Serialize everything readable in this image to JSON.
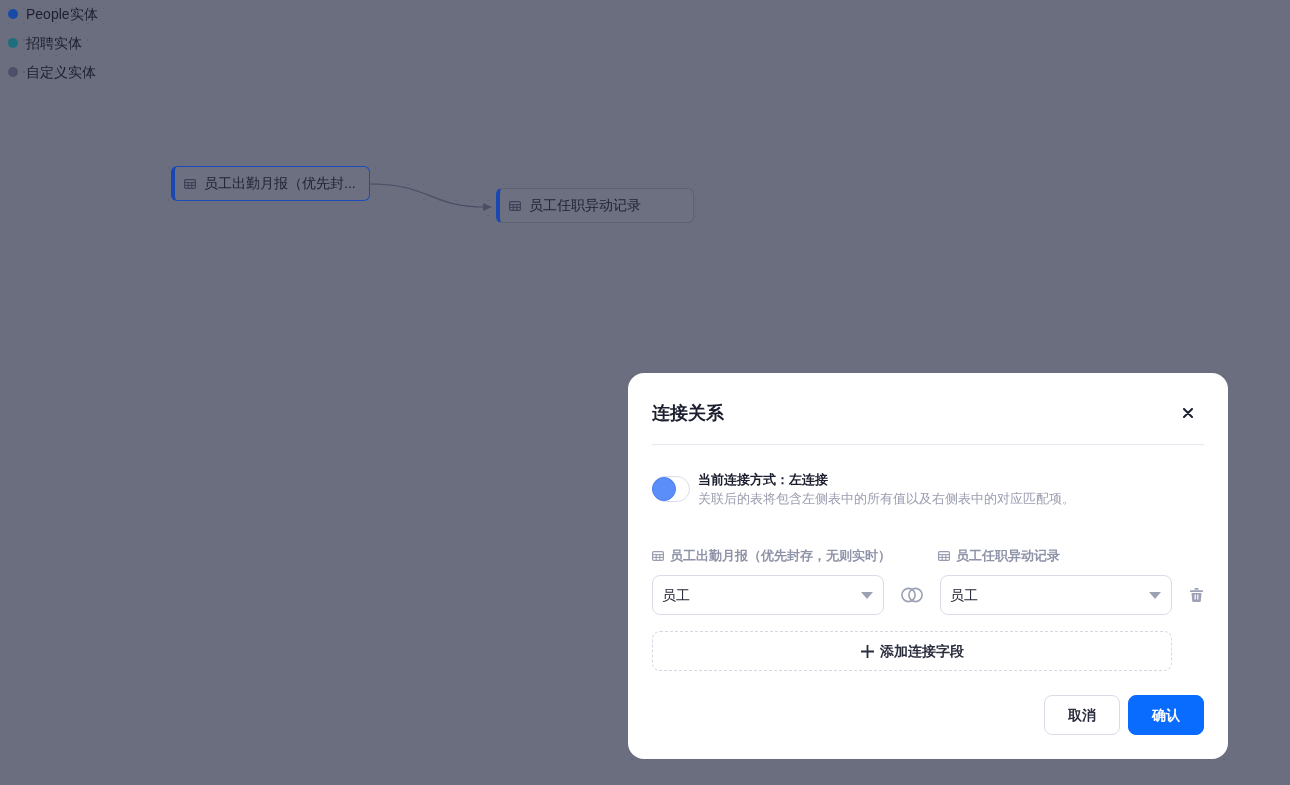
{
  "legend": [
    {
      "label": "People实体",
      "color": "#1a4aa8"
    },
    {
      "label": "招聘实体",
      "color": "#1d6f80"
    },
    {
      "label": "自定义实体",
      "color": "#4d5068"
    }
  ],
  "canvas": {
    "nodes": [
      {
        "label": "员工出勤月报（优先封...",
        "selected": true
      },
      {
        "label": "员工任职异动记录",
        "selected": false
      }
    ]
  },
  "dialog": {
    "title": "连接关系",
    "join_switch": {
      "on": false
    },
    "join_mode": "当前连接方式：左连接",
    "description": "关联后的表将包含左侧表中的所有值以及右侧表中的对应匹配项。",
    "left_table": "员工出勤月报（优先封存，无则实时）",
    "right_table": "员工任职异动记录",
    "conditions": [
      {
        "left_field": "员工",
        "right_field": "员工"
      }
    ],
    "add_button": "添加连接字段",
    "buttons": [
      {
        "label": "取消",
        "kind": "secondary"
      },
      {
        "label": "确认",
        "kind": "primary"
      }
    ]
  }
}
